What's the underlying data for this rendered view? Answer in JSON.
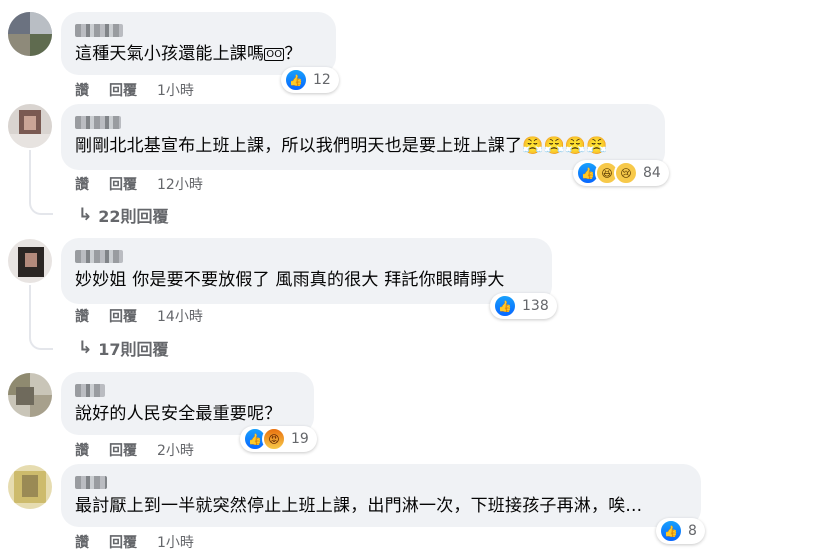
{
  "comments": [
    {
      "text": "這種天氣小孩還能上課嗎",
      "emoji_mark": "ÖÖ",
      "tail": "？",
      "reactions": [
        "like"
      ],
      "reaction_count": "12",
      "actions": {
        "like": "讚",
        "reply": "回覆",
        "time": "1小時"
      }
    },
    {
      "text": "剛剛北北基宣布上班上課，所以我們明天也是要上班上課了😤😤😤😤",
      "reactions": [
        "like",
        "haha",
        "sad"
      ],
      "reaction_count": "84",
      "actions": {
        "like": "讚",
        "reply": "回覆",
        "time": "12小時"
      },
      "replies_label": "22則回覆"
    },
    {
      "text": "妙妙姐 你是要不要放假了 風雨真的很大 拜託你眼睛睜大",
      "reactions": [
        "like"
      ],
      "reaction_count": "138",
      "actions": {
        "like": "讚",
        "reply": "回覆",
        "time": "14小時"
      },
      "replies_label": "17則回覆"
    },
    {
      "text": "說好的人民安全最重要呢？",
      "reactions": [
        "like",
        "angry"
      ],
      "reaction_count": "19",
      "actions": {
        "like": "讚",
        "reply": "回覆",
        "time": "2小時"
      }
    },
    {
      "text": "最討厭上到一半就突然停止上班上課，出門淋一次，下班接孩子再淋，唉...",
      "reactions": [
        "like"
      ],
      "reaction_count": "8",
      "actions": {
        "like": "讚",
        "reply": "回覆",
        "time": "1小時"
      }
    }
  ],
  "icons": {
    "like": "👍",
    "haha": "😆",
    "sad": "😢",
    "angry": "😡",
    "reply_arrow": "↳"
  },
  "colors": {
    "bubble": "#f0f2f5",
    "meta_text": "#65676b",
    "like_blue": "#0866ff"
  }
}
